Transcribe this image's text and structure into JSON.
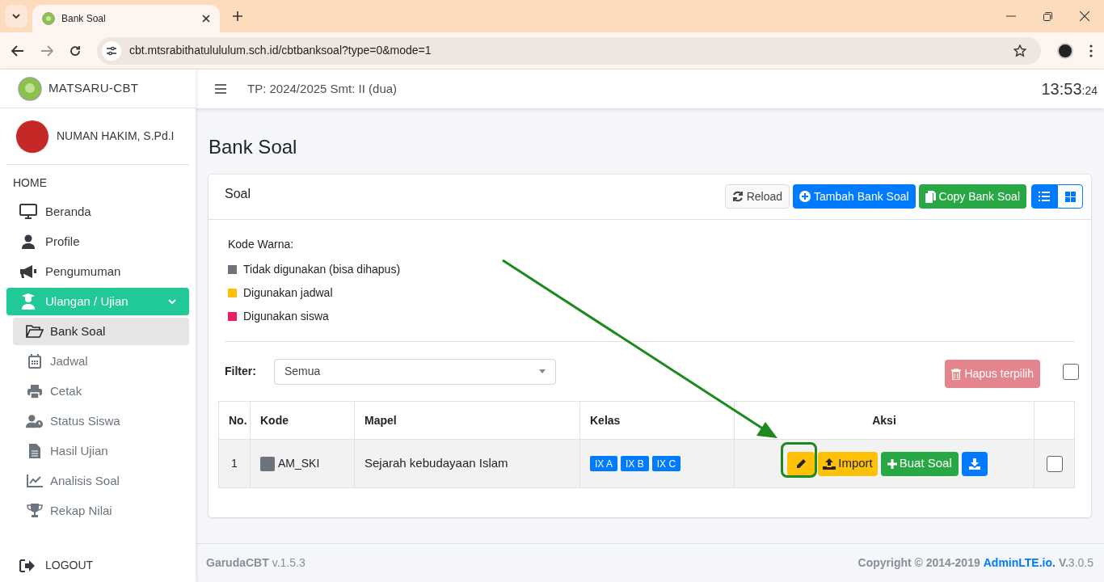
{
  "browser": {
    "tab_title": "Bank Soal",
    "url": "cbt.mtsrabithatulululum.sch.id/cbtbanksoal?type=0&mode=1"
  },
  "brand": "MATSARU-CBT",
  "user": {
    "name": "NUMAN HAKIM, S.Pd.I"
  },
  "sidebar": {
    "header": "HOME",
    "items": [
      {
        "label": "Beranda",
        "selected": false
      },
      {
        "label": "Profile",
        "selected": false
      },
      {
        "label": "Pengumuman",
        "selected": false
      },
      {
        "label": "Ulangan / Ujian",
        "selected": true,
        "expanded": true,
        "children": [
          {
            "label": "Bank Soal",
            "selected": true
          },
          {
            "label": "Jadwal",
            "selected": false
          },
          {
            "label": "Cetak",
            "selected": false
          },
          {
            "label": "Status Siswa",
            "selected": false
          },
          {
            "label": "Hasil Ujian",
            "selected": false
          },
          {
            "label": "Analisis Soal",
            "selected": false
          },
          {
            "label": "Rekap Nilai",
            "selected": false
          }
        ]
      }
    ],
    "logout": "LOGOUT"
  },
  "topbar": {
    "period": "TP: 2024/2025 Smt: II (dua)",
    "clock": "13:53",
    "seconds": ":24"
  },
  "page_title": "Bank Soal",
  "card": {
    "title": "Soal",
    "tools": [
      {
        "kind": "light",
        "label": "Reload"
      },
      {
        "kind": "primary",
        "label": "Tambah Bank Soal"
      },
      {
        "kind": "success",
        "label": "Copy Bank Soal"
      }
    ],
    "views": [
      {
        "kind": "list",
        "selected": true
      },
      {
        "kind": "grid",
        "selected": false
      }
    ],
    "legend_title": "Kode Warna:",
    "legend": [
      {
        "label": "Tidak digunakan (bisa dihapus)",
        "color": "#6c757d"
      },
      {
        "label": "Digunakan jadwal",
        "color": "#ffc107"
      },
      {
        "label": "Digunakan siswa",
        "color": "#e91e63"
      }
    ],
    "filter": {
      "label": "Filter:",
      "value": "Semua"
    },
    "delete_button": {
      "label": "Hapus terpilih",
      "disabled": true
    },
    "select_all": {
      "checked": false
    },
    "table": {
      "columns": [
        "No.",
        "Kode",
        "Mapel",
        "Kelas",
        "Aksi"
      ],
      "rows": [
        {
          "no": "1",
          "kode": "AM_SKI",
          "color": "#6c757d",
          "mapel": "Sejarah kebudayaan Islam",
          "kelas": [
            "IX A",
            "IX B",
            "IX C"
          ],
          "actions": [
            {
              "kind": "edit"
            },
            {
              "kind": "import",
              "label": "Import"
            },
            {
              "kind": "create",
              "label": "Buat Soal"
            },
            {
              "kind": "download"
            }
          ],
          "checked": false
        }
      ]
    }
  },
  "footer": {
    "app": "**GarudaCBT** v.1.5.3",
    "copyright": "Copyright © 2014-2019",
    "link": "AdminLTE.io.",
    "version": "**V.**3.0.5"
  }
}
